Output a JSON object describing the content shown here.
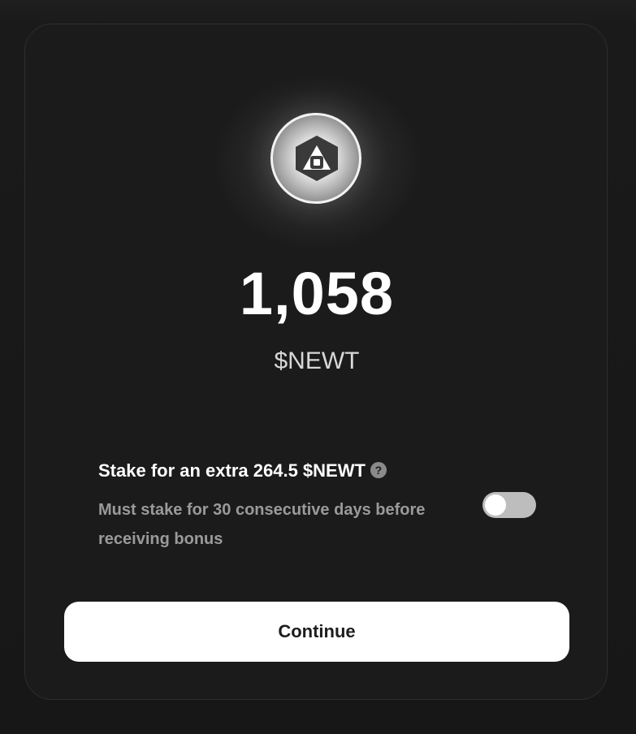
{
  "reward": {
    "amount": "1,058",
    "symbol": "$NEWT",
    "token_icon": "newton-logo-icon"
  },
  "stake": {
    "title": "Stake for an extra 264.5 $NEWT",
    "help_icon_glyph": "?",
    "description": "Must stake for 30 consecutive days before receiving bonus",
    "toggle_on": false
  },
  "actions": {
    "continue_label": "Continue"
  },
  "colors": {
    "background": "#171717",
    "card": "#1b1b1b",
    "primary_text": "#ffffff",
    "secondary_text": "#9a9a9a",
    "button_bg": "#ffffff",
    "toggle_off": "#bdbdbd"
  }
}
